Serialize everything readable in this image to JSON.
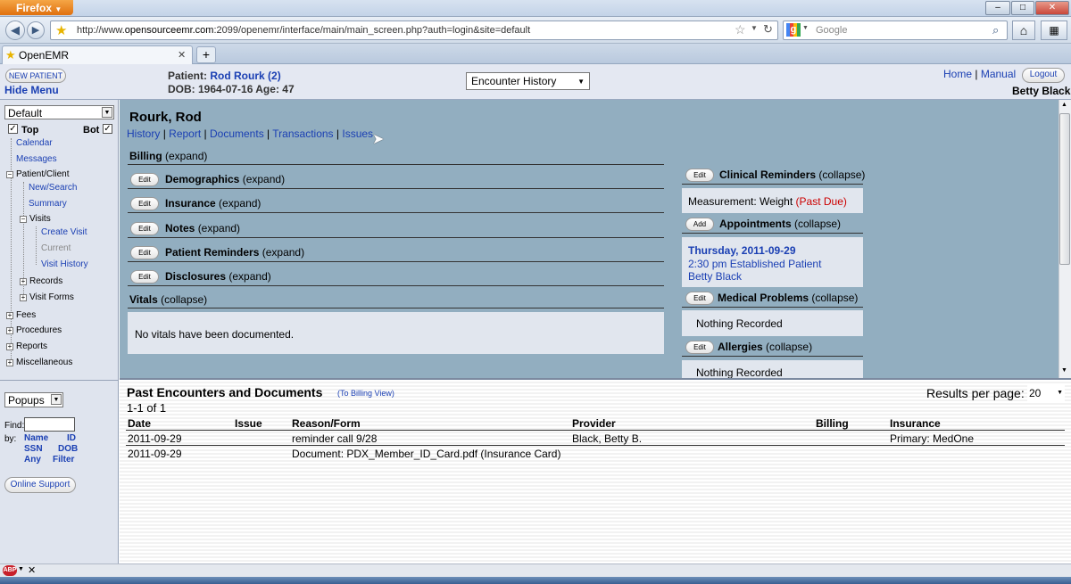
{
  "browser": {
    "app_button": "Firefox",
    "url_prefix": "http://www.",
    "url_domain": "opensourceemr.com",
    "url_rest": ":2099/openemr/interface/main/main_screen.php?auth=login&site=default",
    "search_placeholder": "Google",
    "tab_title": "OpenEMR",
    "new_tab": "+",
    "min": "–",
    "max": "□",
    "close": "✕"
  },
  "header": {
    "new_patient": "NEW PATIENT",
    "hide_menu": "Hide Menu",
    "patient_prefix": "Patient:",
    "patient_name": "Rod Rourk (2)",
    "dob_line": "DOB: 1964-07-16 Age: 47",
    "encounter_select": "Encounter History",
    "home": "Home",
    "sep": "|",
    "manual": "Manual",
    "logout": "Logout",
    "user": "Betty Black"
  },
  "nav": {
    "frame_select": "Default",
    "top_label": "Top",
    "bot_label": "Bot",
    "items": {
      "calendar": "Calendar",
      "messages": "Messages",
      "patient_client": "Patient/Client",
      "new_search": "New/Search",
      "summary": "Summary",
      "visits": "Visits",
      "create_visit": "Create Visit",
      "current": "Current",
      "visit_history": "Visit History",
      "records": "Records",
      "visit_forms": "Visit Forms",
      "fees": "Fees",
      "procedures": "Procedures",
      "reports": "Reports",
      "miscellaneous": "Miscellaneous"
    },
    "popups_select": "Popups",
    "find_label": "Find:",
    "by_label": "by:",
    "find_name": "Name",
    "find_id": "ID",
    "find_ssn": "SSN",
    "find_dob": "DOB",
    "find_any": "Any",
    "find_filter": "Filter",
    "online_support": "Online Support"
  },
  "summary": {
    "patient_heading": "Rourk, Rod",
    "links": [
      "History",
      "Report",
      "Documents",
      "Transactions",
      "Issues"
    ],
    "link_sep": "|",
    "edit_label": "Edit",
    "add_label": "Add",
    "billing": "Billing",
    "expand": "(expand)",
    "collapse": "(collapse)",
    "demographics": "Demographics",
    "insurance": "Insurance",
    "notes": "Notes",
    "patient_reminders": "Patient Reminders",
    "disclosures": "Disclosures",
    "vitals": "Vitals",
    "no_vitals": "No vitals have been documented.",
    "clinical_reminders": "Clinical Reminders",
    "measurement": "Measurement: Weight",
    "past_due": "(Past Due)",
    "appointments": "Appointments",
    "appt_date": "Thursday, 2011-09-29",
    "appt_time": "2:30 pm Established Patient",
    "appt_provider": "Betty Black",
    "medical_problems": "Medical Problems",
    "nothing_recorded": "Nothing Recorded",
    "allergies": "Allergies",
    "allergies_nothing": "Nothing Recorded"
  },
  "encounters": {
    "title": "Past Encounters and Documents",
    "billing_view": "(To Billing View)",
    "results_label": "Results per page:",
    "results_value": "20",
    "range": "1-1 of 1",
    "columns": [
      "Date",
      "Issue",
      "Reason/Form",
      "Provider",
      "Billing",
      "Insurance"
    ],
    "rows": [
      {
        "date": "2011-09-29",
        "issue": "",
        "reason": "reminder call 9/28",
        "provider": "Black, Betty B.",
        "billing": "",
        "insurance": "Primary: MedOne"
      },
      {
        "date": "2011-09-29",
        "issue": "",
        "reason": "Document: PDX_Member_ID_Card.pdf (Insurance Card)",
        "provider": "",
        "billing": "",
        "insurance": ""
      }
    ]
  },
  "colors": {
    "main_bg": "#92aec0",
    "link": "#1a3fb3",
    "past_due": "#cc0000"
  }
}
